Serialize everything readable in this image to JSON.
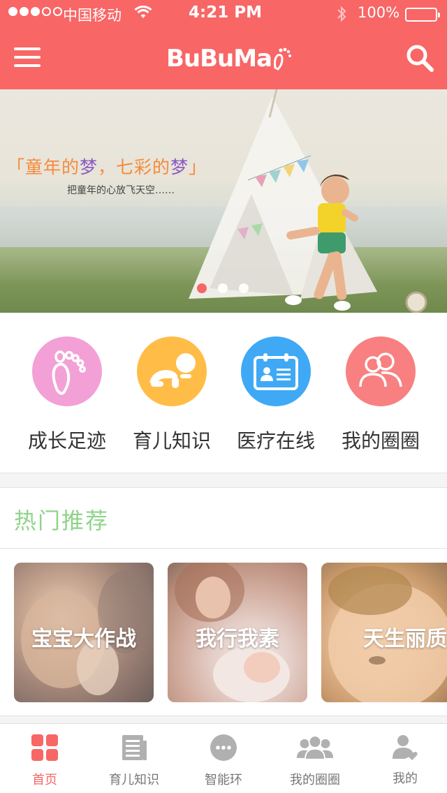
{
  "status_bar": {
    "carrier": "中国移动",
    "time": "4:21 PM",
    "battery_text": "100%",
    "signal_dots": [
      true,
      true,
      true,
      false,
      false
    ]
  },
  "header": {
    "logo_text": "BuBuMa",
    "menu_icon": "hamburger-menu-icon",
    "search_icon": "search-icon",
    "background_color": "#f86666"
  },
  "banner": {
    "slogan_part1": "「童年的",
    "slogan_dream1": "梦",
    "slogan_part2": "，七彩的",
    "slogan_dream2": "梦",
    "slogan_part3": "」",
    "subtitle": "把童年的心放飞天空……",
    "slides": 3,
    "active_slide": 1
  },
  "quick_links": [
    {
      "label": "成长足迹",
      "icon": "footprint-icon",
      "color": "#f3a0d6"
    },
    {
      "label": "育儿知识",
      "icon": "crawling-baby-icon",
      "color": "#ffbd47"
    },
    {
      "label": "医疗在线",
      "icon": "medical-id-card-icon",
      "color": "#3fa9f5"
    },
    {
      "label": "我的圈圈",
      "icon": "users-group-icon",
      "color": "#f88080"
    }
  ],
  "hot_section": {
    "title": "热门推荐"
  },
  "recommend_cards": [
    {
      "label": "宝宝大作战"
    },
    {
      "label": "我行我素"
    },
    {
      "label": "天生丽质"
    }
  ],
  "tabbar": [
    {
      "label": "首页",
      "icon": "home-grid-icon",
      "active": true
    },
    {
      "label": "育儿知识",
      "icon": "newspaper-icon",
      "active": false
    },
    {
      "label": "智能环",
      "icon": "chat-bubble-icon",
      "active": false
    },
    {
      "label": "我的圈圈",
      "icon": "group-icon",
      "active": false
    },
    {
      "label": "我的",
      "icon": "user-heart-icon",
      "active": false
    }
  ],
  "colors": {
    "accent": "#f86666",
    "hot_title": "#8fd48a",
    "tab_inactive": "#aaaaaa"
  }
}
